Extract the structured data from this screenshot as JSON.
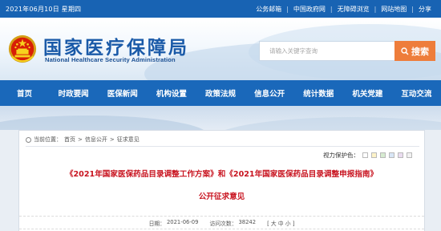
{
  "topbar": {
    "date": "2021年06月10日 星期四",
    "links": [
      "公务邮箱",
      "中国政府网",
      "无障碍浏览",
      "网站地图",
      "分享"
    ]
  },
  "header": {
    "title": "国家医疗保障局",
    "subtitle": "National Healthcare Security Administration",
    "search_placeholder": "请输入关键字查询",
    "search_button": "搜索"
  },
  "nav": {
    "items": [
      "首页",
      "时政要闻",
      "医保新闻",
      "机构设置",
      "政策法规",
      "信息公开",
      "统计数据",
      "机关党建",
      "互动交流"
    ]
  },
  "breadcrumb": {
    "prefix": "当前位置：",
    "parts": [
      "首页",
      "信息公开",
      "征求意见"
    ],
    "separator": ">"
  },
  "vision": {
    "label": "视力保护色：",
    "swatches": [
      "#ffffff",
      "#fdf3c8",
      "#d6ebd0",
      "#d8e6f6",
      "#eadcf0",
      "#f2f2f2"
    ]
  },
  "article": {
    "title": "《2021年国家医保药品目录调整工作方案》和《2021年国家医保药品目录调整申报指南》",
    "subtitle": "公开征求意见",
    "date_label": "日期：",
    "date": "2021-06-09",
    "views_label": "访问次数：",
    "views": "38242",
    "font_label": "[ 大 中 小 ]"
  },
  "colors": {
    "brand_blue": "#1a68ba",
    "accent_orange": "#ee7d3b",
    "title_red": "#c8131f"
  }
}
